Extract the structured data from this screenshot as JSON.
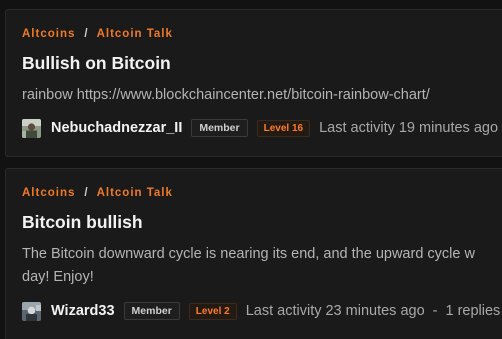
{
  "posts": [
    {
      "breadcrumb": {
        "category": "Altcoins",
        "separator": "/",
        "subcategory": "Altcoin Talk"
      },
      "title": "Bullish on Bitcoin",
      "excerpt": "rainbow https://www.blockchaincenter.net/bitcoin-rainbow-chart/",
      "author": {
        "name": "Nebuchadnezzar_II",
        "avatar_icon": "user-avatar-photo",
        "role": "Member",
        "level": "Level 16"
      },
      "activity": "Last activity 19 minutes ago"
    },
    {
      "breadcrumb": {
        "category": "Altcoins",
        "separator": "/",
        "subcategory": "Altcoin Talk"
      },
      "title": "Bitcoin bullish",
      "excerpt_lines": [
        "The Bitcoin downward cycle is nearing its end, and the upward cycle w",
        "day! Enjoy!"
      ],
      "author": {
        "name": "Wizard33",
        "avatar_icon": "user-avatar-photo",
        "role": "Member",
        "level": "Level 2"
      },
      "activity": "Last activity 23 minutes ago",
      "separator": "-",
      "replies": "1 replies"
    }
  ],
  "colors": {
    "background": "#121212",
    "card": "#1a1a1a",
    "accent": "#f07a2a",
    "text": "#f2f2f2",
    "muted": "#b4b4b4"
  }
}
